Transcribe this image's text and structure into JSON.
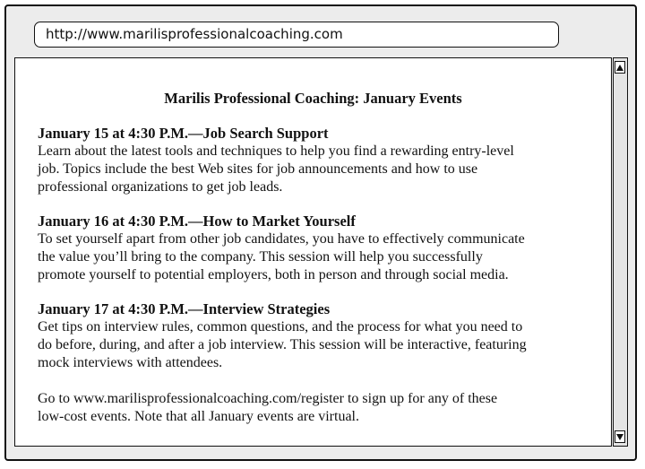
{
  "browser": {
    "url": "http://www.marilisprofessionalcoaching.com"
  },
  "page": {
    "heading": "Marilis Professional Coaching: January Events",
    "events": [
      {
        "title": "January 15 at 4:30 P.M.—Job Search Support",
        "lines": [
          "Learn about the latest tools and techniques to help you find a rewarding entry-level",
          "job. Topics include the best Web sites for job announcements and how to use",
          "professional organizations to get job leads."
        ]
      },
      {
        "title": "January 16  at 4:30 P.M.—How to Market Yourself",
        "lines": [
          "To set yourself apart from other job candidates, you have to effectively communicate",
          "the value you’ll bring to the company. This session will help you successfully",
          "promote yourself to potential employers, both in person and through social media."
        ]
      },
      {
        "title": "January 17 at  4:30 P.M.—Interview Strategies",
        "lines": [
          "Get tips on interview rules, common questions, and the process for what you need to",
          "do before, during, and after a job interview. This session will be interactive, featuring",
          "mock interviews with attendees."
        ]
      }
    ],
    "closing": [
      "Go to www.marilisprofessionalcoaching.com/register to sign up for any of these",
      "low-cost events. Note that all January events are virtual."
    ]
  }
}
